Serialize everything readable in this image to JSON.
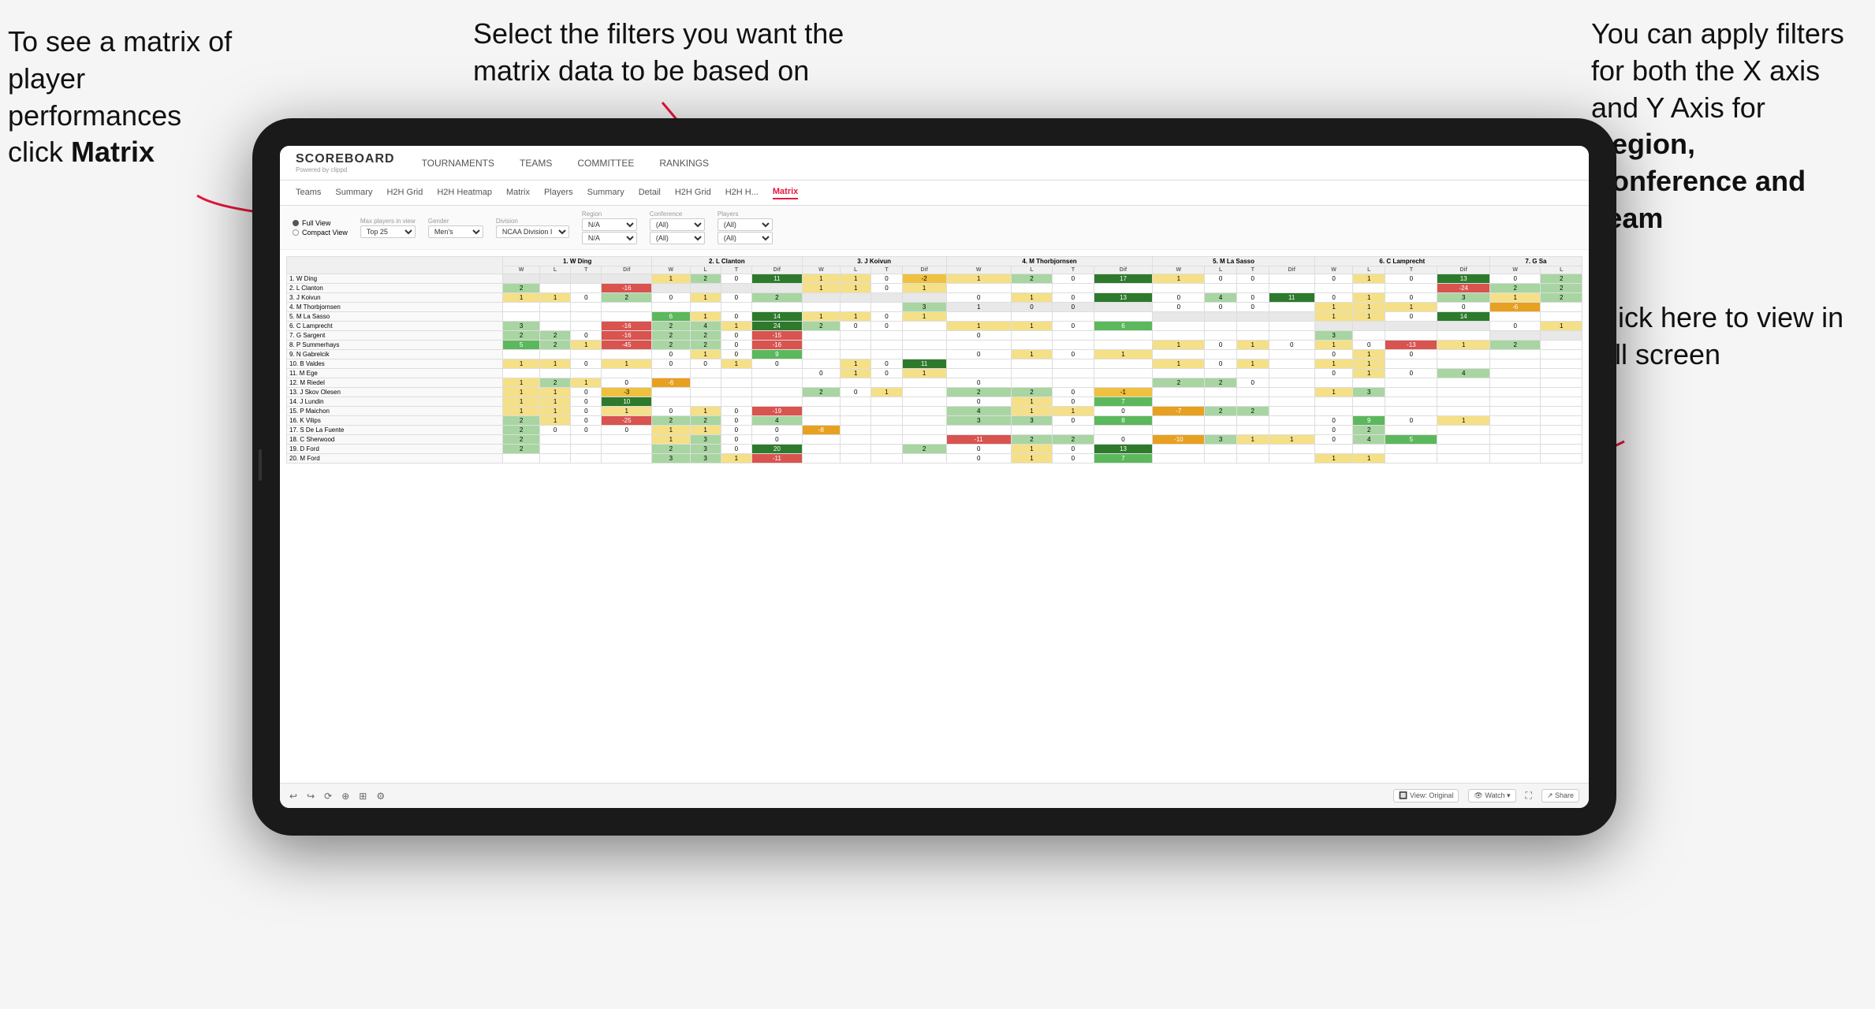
{
  "annotations": {
    "left": {
      "line1": "To see a matrix of",
      "line2": "player performances",
      "line3": "click ",
      "bold": "Matrix"
    },
    "center": {
      "text": "Select the filters you want the matrix data to be based on"
    },
    "right": {
      "text1": "You  can apply filters for both the X axis and Y Axis for ",
      "bold1": "Region, Conference and",
      "bold2": "Team"
    },
    "bottom_right": {
      "text": "Click here to view in full screen"
    }
  },
  "nav": {
    "logo": "SCOREBOARD",
    "logo_sub": "Powered by clippd",
    "items": [
      "TOURNAMENTS",
      "TEAMS",
      "COMMITTEE",
      "RANKINGS"
    ]
  },
  "sub_nav": {
    "items": [
      "Teams",
      "Summary",
      "H2H Grid",
      "H2H Heatmap",
      "Matrix",
      "Players",
      "Summary",
      "Detail",
      "H2H Grid",
      "H2H H...",
      "Matrix"
    ]
  },
  "filters": {
    "view_options": [
      "Full View",
      "Compact View"
    ],
    "groups": [
      {
        "label": "Max players in view",
        "value": "Top 25"
      },
      {
        "label": "Gender",
        "value": "Men's"
      },
      {
        "label": "Division",
        "value": "NCAA Division I"
      },
      {
        "label": "Region",
        "values": [
          "N/A",
          "N/A"
        ]
      },
      {
        "label": "Conference",
        "values": [
          "(All)",
          "(All)"
        ]
      },
      {
        "label": "Players",
        "values": [
          "(All)",
          "(All)"
        ]
      }
    ]
  },
  "matrix": {
    "col_headers": [
      "1. W Ding",
      "2. L Clanton",
      "3. J Koivun",
      "4. M Thorbjornsen",
      "5. M La Sasso",
      "6. C Lamprecht",
      "7. G Sa"
    ],
    "sub_headers": [
      "W",
      "L",
      "T",
      "Dif"
    ],
    "rows": [
      {
        "name": "1. W Ding",
        "cells": [
          "",
          "",
          "",
          "",
          "1",
          "2",
          "0",
          "11",
          "1",
          "1",
          "0",
          "-2",
          "1",
          "2",
          "0",
          "17",
          "1",
          "0",
          "0",
          "",
          "0",
          "1",
          "0",
          "13",
          "0",
          "2"
        ]
      },
      {
        "name": "2. L Clanton",
        "cells": [
          "2",
          "",
          "",
          "-16",
          "",
          "",
          "",
          "",
          "1",
          "1",
          "0",
          "1",
          "",
          "",
          "",
          "",
          "",
          "",
          "",
          "",
          "",
          "",
          "",
          "-24",
          "2",
          "2"
        ]
      },
      {
        "name": "3. J Koivun",
        "cells": [
          "1",
          "1",
          "0",
          "2",
          "0",
          "1",
          "0",
          "2",
          "",
          "",
          "",
          "",
          "0",
          "1",
          "0",
          "13",
          "0",
          "4",
          "0",
          "11",
          "0",
          "1",
          "0",
          "3",
          "1",
          "2"
        ]
      },
      {
        "name": "4. M Thorbjornsen",
        "cells": [
          "",
          "",
          "",
          "",
          "",
          "",
          "",
          "",
          "",
          "",
          "",
          "3",
          "1",
          "0",
          "0",
          "",
          "0",
          "0",
          "0",
          "",
          "1",
          "1",
          "1",
          "0",
          "-6",
          ""
        ]
      },
      {
        "name": "5. M La Sasso",
        "cells": [
          "",
          "",
          "",
          "",
          "6",
          "1",
          "0",
          "14",
          "1",
          "1",
          "0",
          "1",
          "",
          "",
          "",
          "",
          "",
          "",
          "",
          "",
          "1",
          "1",
          "0",
          "14",
          ""
        ]
      },
      {
        "name": "6. C Lamprecht",
        "cells": [
          "3",
          "",
          "",
          "-16",
          "2",
          "4",
          "1",
          "24",
          "2",
          "0",
          "0",
          "",
          "1",
          "1",
          "0",
          "6",
          "",
          "",
          "",
          "",
          "",
          "",
          "",
          "",
          "0",
          "1"
        ]
      },
      {
        "name": "7. G Sargent",
        "cells": [
          "2",
          "2",
          "0",
          "-16",
          "2",
          "2",
          "0",
          "-15",
          "",
          "",
          "",
          "",
          "0",
          "",
          "",
          "",
          "",
          "",
          "",
          "",
          "3",
          "",
          "",
          "",
          ""
        ]
      },
      {
        "name": "8. P Summerhays",
        "cells": [
          "5",
          "2",
          "1",
          "-45",
          "2",
          "2",
          "0",
          "-16",
          "",
          "",
          "",
          "",
          "",
          "",
          "",
          "",
          "1",
          "0",
          "1",
          "0",
          "1",
          "0",
          "-13",
          "1",
          "2"
        ]
      },
      {
        "name": "9. N Gabrelcik",
        "cells": [
          "",
          "",
          "",
          "",
          "0",
          "1",
          "0",
          "9",
          "",
          "",
          "",
          "",
          "0",
          "1",
          "0",
          "1",
          "",
          "",
          "",
          "",
          "0",
          "1",
          "0",
          "",
          ""
        ]
      },
      {
        "name": "10. B Valdes",
        "cells": [
          "1",
          "1",
          "0",
          "1",
          "0",
          "0",
          "1",
          "0",
          "",
          "1",
          "0",
          "11",
          "",
          "",
          "",
          "",
          "1",
          "0",
          "1",
          "",
          "1",
          "1"
        ]
      },
      {
        "name": "11. M Ege",
        "cells": [
          "",
          "",
          "",
          "",
          "",
          "",
          "",
          "",
          "0",
          "1",
          "0",
          "1",
          "",
          "",
          "",
          "",
          "",
          "",
          "",
          "",
          "0",
          "1",
          "0",
          "4"
        ]
      },
      {
        "name": "12. M Riedel",
        "cells": [
          "1",
          "2",
          "1",
          "0",
          "-6",
          "",
          "",
          "",
          "",
          "",
          "",
          "",
          "0",
          "",
          "",
          "",
          "2",
          "2",
          "0",
          "",
          "",
          "",
          "",
          "",
          ""
        ]
      },
      {
        "name": "13. J Skov Olesen",
        "cells": [
          "1",
          "1",
          "0",
          "-3",
          "",
          "",
          "",
          "",
          "2",
          "0",
          "1",
          "",
          "2",
          "2",
          "0",
          "-1",
          "",
          "",
          "",
          "",
          "1",
          "3"
        ]
      },
      {
        "name": "14. J Lundin",
        "cells": [
          "1",
          "1",
          "0",
          "10",
          "",
          "",
          "",
          "",
          "",
          "",
          "",
          "",
          "0",
          "1",
          "0",
          "7",
          "",
          "",
          "",
          "",
          "",
          ""
        ]
      },
      {
        "name": "15. P Maichon",
        "cells": [
          "1",
          "1",
          "0",
          "1",
          "0",
          "1",
          "0",
          "-19",
          "",
          "",
          "",
          "",
          "4",
          "1",
          "1",
          "0",
          "-7",
          "2",
          "2"
        ]
      },
      {
        "name": "16. K Vilips",
        "cells": [
          "2",
          "1",
          "0",
          "-25",
          "2",
          "2",
          "0",
          "4",
          "",
          "",
          "",
          "",
          "3",
          "3",
          "0",
          "8",
          "",
          "",
          "",
          "",
          "0",
          "9",
          "0",
          "1"
        ]
      },
      {
        "name": "17. S De La Fuente",
        "cells": [
          "2",
          "0",
          "0",
          "0",
          "1",
          "1",
          "0",
          "0",
          "-8",
          "",
          "",
          "",
          "",
          "",
          "",
          "",
          "",
          "",
          "",
          "",
          "0",
          "2"
        ]
      },
      {
        "name": "18. C Sherwood",
        "cells": [
          "2",
          "",
          "",
          "",
          "1",
          "3",
          "0",
          "0",
          "",
          "",
          "",
          "",
          "-11",
          "2",
          "2",
          "0",
          "-10",
          "3",
          "1",
          "1",
          "0",
          "4",
          "5"
        ]
      },
      {
        "name": "19. D Ford",
        "cells": [
          "2",
          "",
          "",
          "",
          "2",
          "3",
          "0",
          "20",
          "",
          "",
          "",
          "2",
          "0",
          "1",
          "0",
          "13",
          "",
          "",
          "",
          "",
          ""
        ]
      },
      {
        "name": "20. M Ford",
        "cells": [
          "",
          "",
          "",
          "",
          "3",
          "3",
          "1",
          "-11",
          "",
          "",
          "",
          "",
          "0",
          "1",
          "0",
          "7",
          "",
          "",
          "",
          "",
          "1",
          "1"
        ]
      }
    ]
  },
  "toolbar": {
    "icons": [
      "↩",
      "↪",
      "⟳",
      "⊕",
      "⬚",
      "◎"
    ],
    "view_label": "View: Original",
    "watch_label": "Watch ▾",
    "share_label": "Share"
  }
}
